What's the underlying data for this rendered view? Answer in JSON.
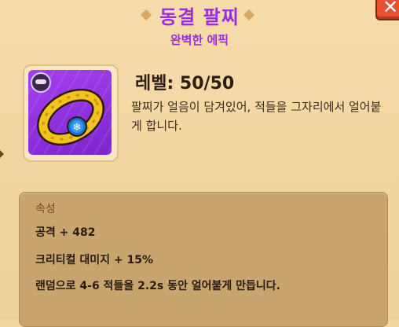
{
  "header": {
    "title": "동결 팔찌",
    "rarity": "완벽한 에픽",
    "close_label": "✕"
  },
  "item": {
    "icon_name": "frozen-bracelet-icon",
    "badge_icon_name": "equipment-slot-badge-icon",
    "level": "레벨: 50/50",
    "description": "팔찌가 얼음이 담겨있어, 적들을 그자리에서 얼어붙게 합니다."
  },
  "attributes": {
    "heading": "속성",
    "lines": [
      "공격 + 482",
      "크리티컬 대미지 + 15%",
      "랜덤으로 4-6 적들을 2.2s 동안 얼어붙게 만듭니다."
    ]
  },
  "colors": {
    "rarity_purple": "#9a2fd9",
    "card_purple": "#8a2fe0",
    "gold": "#f2c21d",
    "panel_bg": "#f3d7a2",
    "close_red": "#e8502f"
  }
}
